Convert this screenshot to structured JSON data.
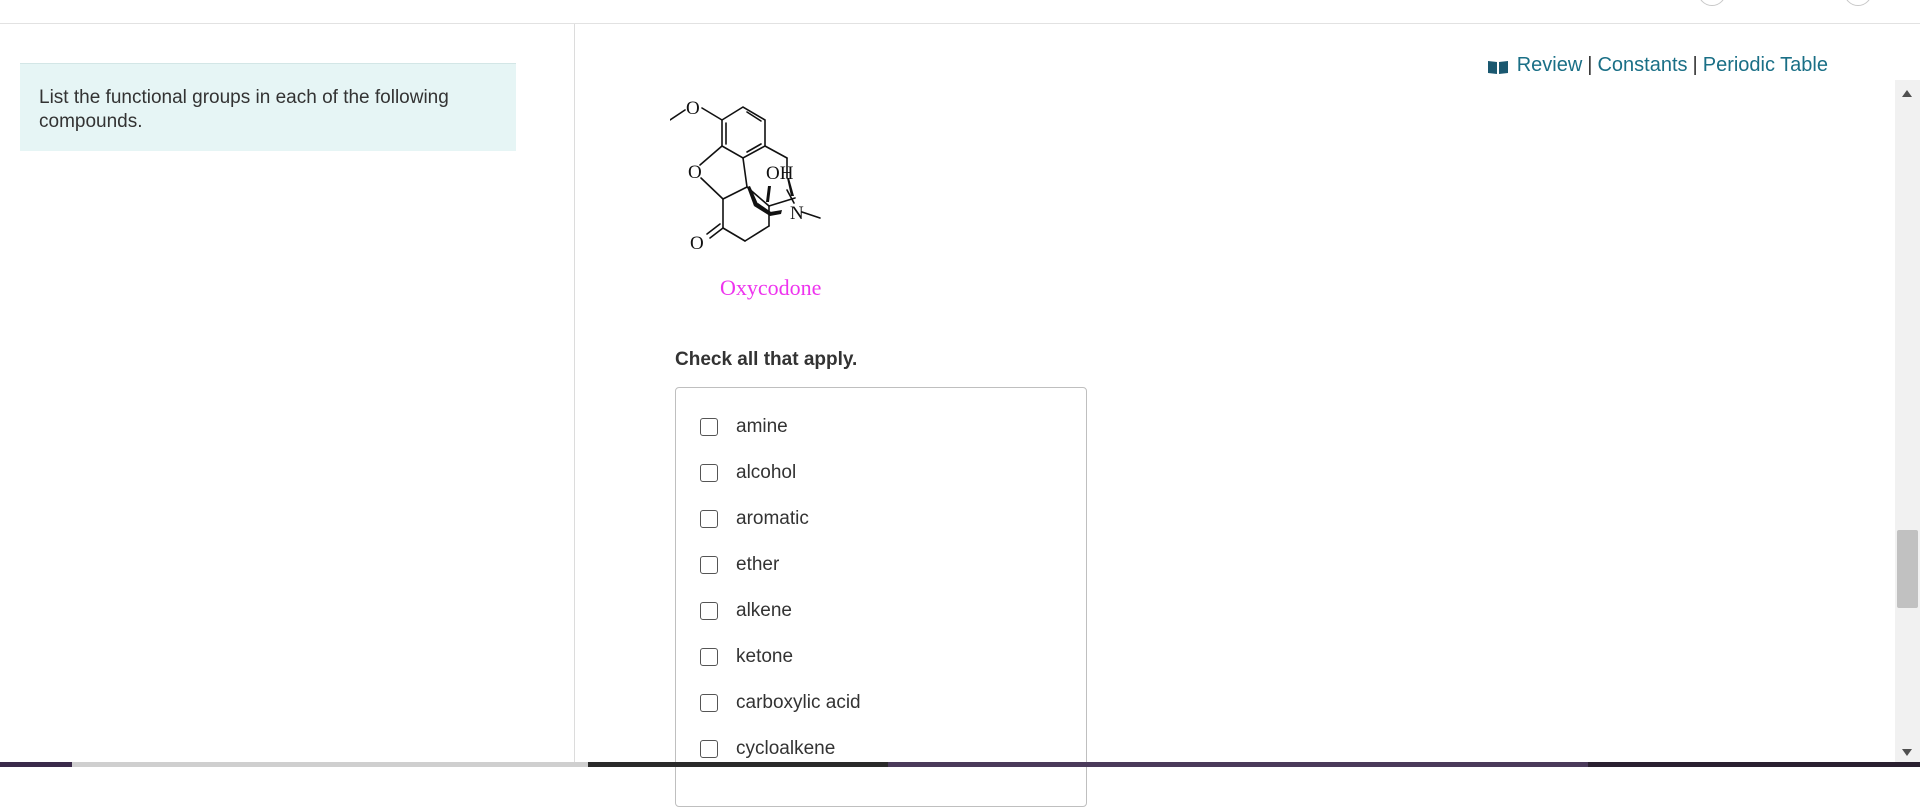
{
  "instructions": {
    "text": "List the functional groups in each of the following compounds."
  },
  "resources": {
    "icon": "book-icon",
    "review_label": "Review",
    "constants_label": "Constants",
    "periodic_table_label": "Periodic Table",
    "separator": "|"
  },
  "structure": {
    "atom_o_methoxy": "O",
    "atom_o_ring": "O",
    "atom_oh": "OH",
    "atom_n": "N",
    "atom_o_ketone": "O",
    "compound_name": "Oxycodone"
  },
  "question": {
    "prompt": "Check all that apply.",
    "options": [
      {
        "label": "amine",
        "checked": false
      },
      {
        "label": "alcohol",
        "checked": false
      },
      {
        "label": "aromatic",
        "checked": false
      },
      {
        "label": "ether",
        "checked": false
      },
      {
        "label": "alkene",
        "checked": false
      },
      {
        "label": "ketone",
        "checked": false
      },
      {
        "label": "carboxylic acid",
        "checked": false
      },
      {
        "label": "cycloalkene",
        "checked": false
      }
    ]
  },
  "colors": {
    "link": "#1a6f86",
    "instructions_bg": "#e6f5f5",
    "compound_name": "#ee33ee"
  }
}
